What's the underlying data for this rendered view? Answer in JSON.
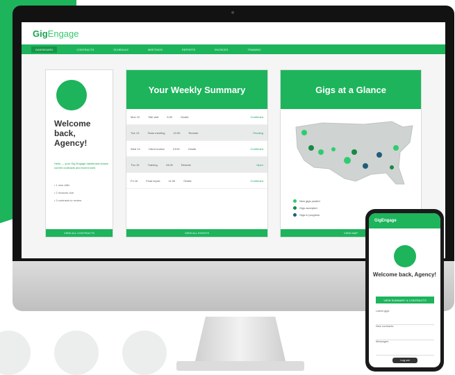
{
  "app": {
    "logo_main": "Gig",
    "logo_alt": "Engage"
  },
  "nav": {
    "items": [
      "DASHBOARD",
      "CONTRACTS",
      "SCHEDULE",
      "MEETINGS",
      "REPORTS",
      "INVOICES",
      "TRAINING"
    ]
  },
  "welcome_panel": {
    "heading": "Welcome back, Agency!",
    "intro": "Hello — your Gig Engage dashboard shows current contracts and recent work",
    "bullets": [
      "1 new offer",
      "2 invoices due",
      "3 contracts to review"
    ],
    "button": "VIEW ALL CONTRACTS"
  },
  "summary_panel": {
    "title": "Your Weekly Summary",
    "rows": [
      {
        "date": "Mon 12",
        "desc": "Site visit",
        "time": "9:00",
        "type": "Onsite",
        "status": "Confirmed"
      },
      {
        "date": "Tue 13",
        "desc": "Team meeting",
        "time": "10:30",
        "type": "Remote",
        "status": "Pending"
      },
      {
        "date": "Wed 14",
        "desc": "Client review",
        "time": "13:00",
        "type": "Onsite",
        "status": "Confirmed"
      },
      {
        "date": "Thu 15",
        "desc": "Training",
        "time": "15:00",
        "type": "Remote",
        "status": "Open"
      },
      {
        "date": "Fri 16",
        "desc": "Final report",
        "time": "11:00",
        "type": "Onsite",
        "status": "Confirmed"
      }
    ],
    "button": "VIEW ALL EVENTS"
  },
  "map_panel": {
    "title": "Gigs at a Glance",
    "legend": [
      "New gigs posted",
      "Gigs accepted",
      "Gigs in progress"
    ],
    "button": "VIEW MAP",
    "colors": {
      "posted": "#2ecc71",
      "accepted": "#178a45",
      "progress": "#1f5d7a"
    }
  },
  "phone": {
    "logo": "GigEngage",
    "heading": "Welcome back, Agency!",
    "button": "VIEW SUMMARY & CONTRACTS",
    "items": [
      "Latest gigs",
      "New contracts",
      "Messages"
    ],
    "bottom_button": "Log out"
  },
  "colors": {
    "brand_green": "#1db45c",
    "dark_green": "#159648"
  }
}
